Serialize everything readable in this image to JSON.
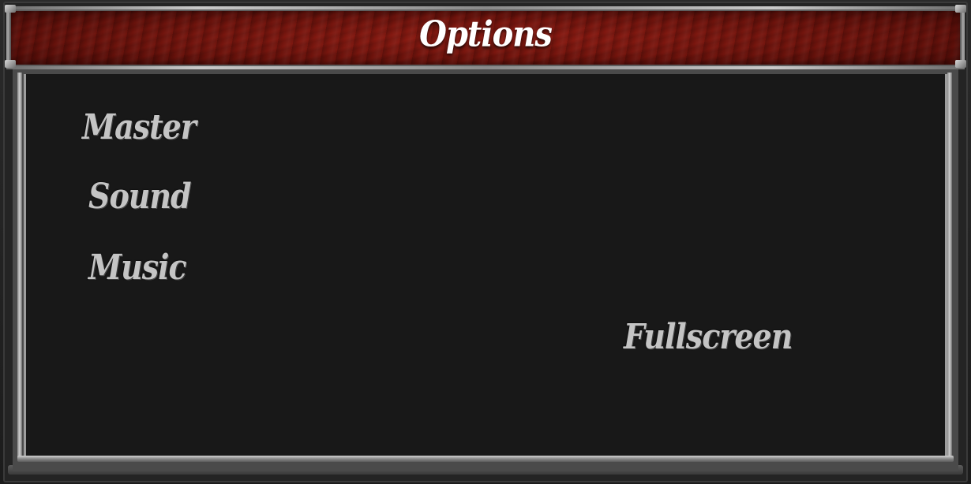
{
  "window": {
    "title": "Options"
  },
  "settings": {
    "master_label": "Master",
    "sound_label": "Sound",
    "music_label": "Music",
    "fullscreen_label": "Fullscreen"
  },
  "colors": {
    "title_bar": "#7a150e",
    "panel_background": "#181818",
    "frame_metal": "#9c9c9c",
    "label_text": "#c4c4c4",
    "title_text": "#ffffff"
  }
}
